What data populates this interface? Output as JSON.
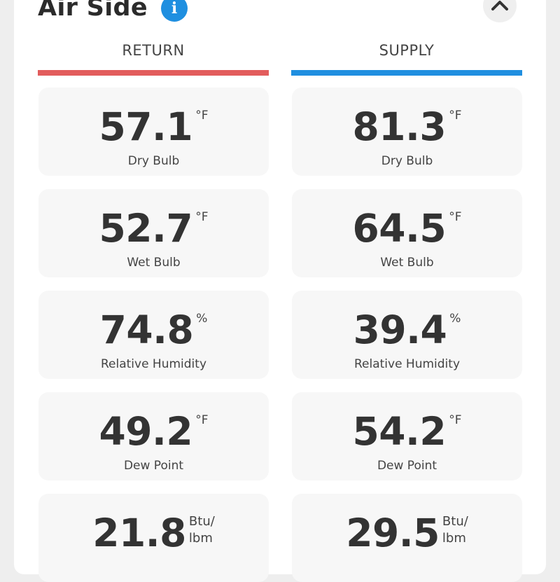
{
  "section": {
    "title": "Air Side",
    "info_icon": "info-icon",
    "collapse_icon": "chevron-up-icon"
  },
  "colors": {
    "return": "#e25c5c",
    "supply": "#1f8fe0"
  },
  "columns": {
    "return": {
      "header": "RETURN",
      "metrics": [
        {
          "value": "57.1",
          "unit": "°F",
          "label": "Dry Bulb"
        },
        {
          "value": "52.7",
          "unit": "°F",
          "label": "Wet Bulb"
        },
        {
          "value": "74.8",
          "unit": "%",
          "label": "Relative Humidity"
        },
        {
          "value": "49.2",
          "unit": "°F",
          "label": "Dew Point"
        },
        {
          "value": "21.8",
          "unit": "Btu/ lbm",
          "unit_l1": "Btu/",
          "unit_l2": "lbm"
        }
      ]
    },
    "supply": {
      "header": "SUPPLY",
      "metrics": [
        {
          "value": "81.3",
          "unit": "°F",
          "label": "Dry Bulb"
        },
        {
          "value": "64.5",
          "unit": "°F",
          "label": "Wet Bulb"
        },
        {
          "value": "39.4",
          "unit": "%",
          "label": "Relative Humidity"
        },
        {
          "value": "54.2",
          "unit": "°F",
          "label": "Dew Point"
        },
        {
          "value": "29.5",
          "unit": "Btu/ lbm",
          "unit_l1": "Btu/",
          "unit_l2": "lbm"
        }
      ]
    }
  }
}
